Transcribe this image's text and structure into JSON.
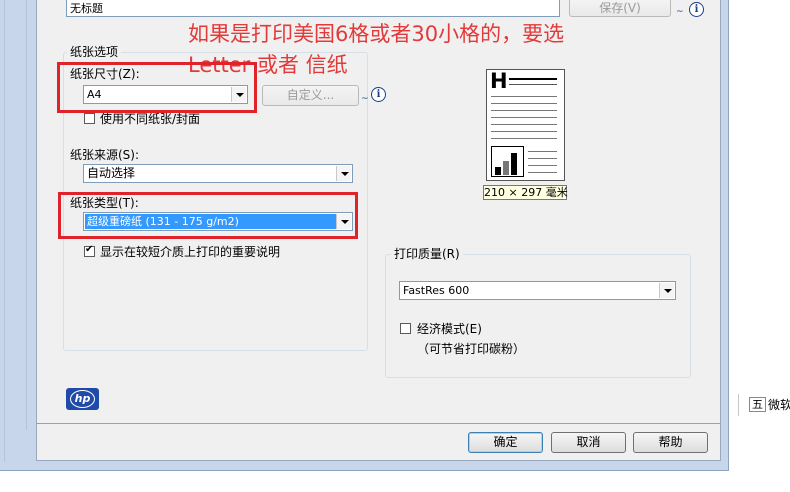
{
  "top": {
    "doc_name": "无标题",
    "save_label": "保存(V)",
    "info_glyph": "i"
  },
  "annotation": {
    "line1": "如果是打印美国6格或者30小格的，要选",
    "line2": "Letter 或者 信纸"
  },
  "paper_options": {
    "group_label": "纸张选项",
    "size_label": "纸张尺寸(Z):",
    "size_value": "A4",
    "custom_label": "自定义...",
    "diff_paper_label": "使用不同纸张/封面",
    "source_label": "纸张来源(S):",
    "source_value": "自动选择",
    "type_label": "纸张类型(T):",
    "type_value": "超级重磅纸 (131 - 175 g/m2)",
    "show_tips_label": "显示在较短介质上打印的重要说明"
  },
  "preview": {
    "dimension_label": "210 × 297 毫米",
    "letter": "H"
  },
  "print_quality": {
    "group_label": "打印质量(R)",
    "value": "FastRes 600",
    "economode_label": "经济模式(E)",
    "economode_note": "（可节省打印碳粉）"
  },
  "footer": {
    "logo_text": "hp",
    "ok_label": "确定",
    "cancel_label": "取消",
    "help_label": "帮助"
  },
  "background_app": {
    "ime_label": "五",
    "truncated_text": "微软"
  },
  "colors": {
    "annotation_red": "#e23a3a",
    "highlight_box": "#e0222b",
    "selection_blue": "#3399ff",
    "hp_blue": "#1f4aa8"
  }
}
